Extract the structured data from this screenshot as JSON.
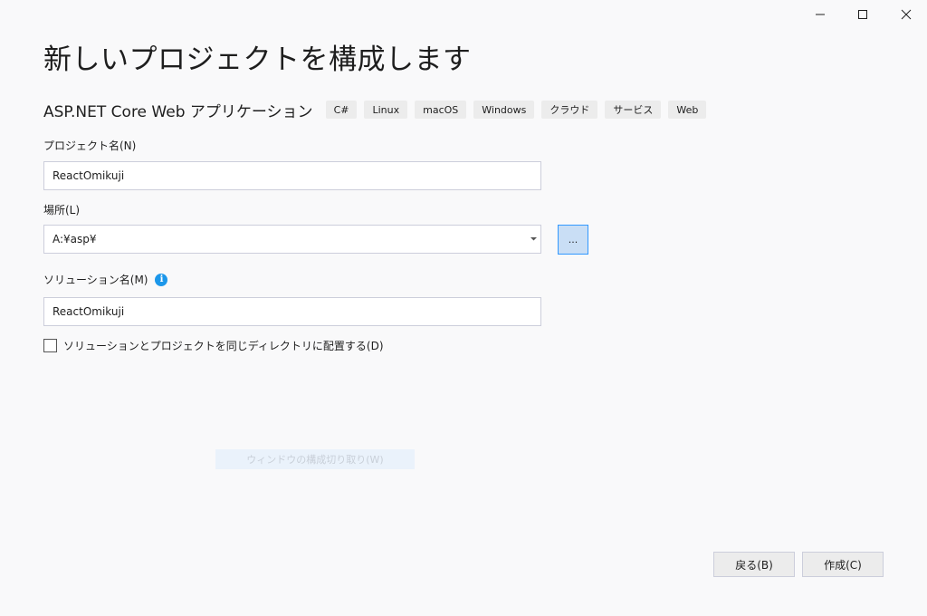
{
  "window_controls": {
    "minimize_icon": "minimize-icon",
    "maximize_icon": "maximize-icon",
    "close_icon": "close-icon"
  },
  "page_title": "新しいプロジェクトを構成します",
  "template": {
    "name": "ASP.NET Core Web アプリケーション",
    "tags": [
      "C#",
      "Linux",
      "macOS",
      "Windows",
      "クラウド",
      "サービス",
      "Web"
    ]
  },
  "project_name": {
    "label": "プロジェクト名(N)",
    "value": "ReactOmikuji"
  },
  "location": {
    "label": "場所(L)",
    "value": "A:¥asp¥",
    "browse_label": "..."
  },
  "solution_name": {
    "label": "ソリューション名(M)",
    "value": "ReactOmikuji",
    "info_icon": "info-icon"
  },
  "same_directory": {
    "label": "ソリューションとプロジェクトを同じディレクトリに配置する(D)",
    "checked": false
  },
  "ghost_text": "ウィンドウの構成切り取り(W)",
  "buttons": {
    "back": "戻る(B)",
    "create": "作成(C)"
  },
  "colors": {
    "background": "#f9f9fa",
    "accent": "#3399ff",
    "info": "#1c97ea",
    "browse_fill": "#c9def5"
  }
}
